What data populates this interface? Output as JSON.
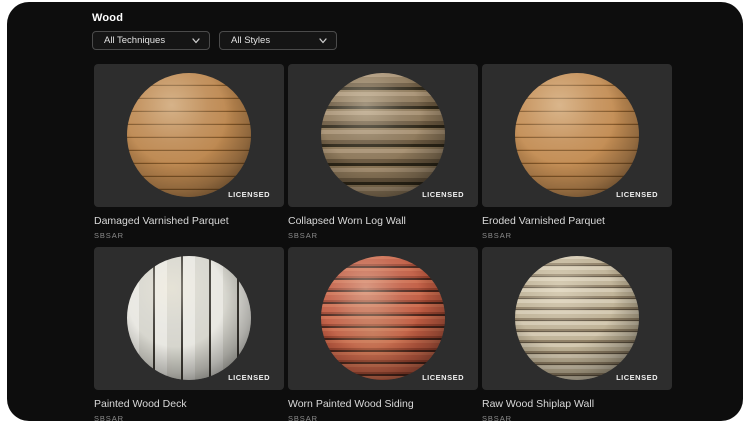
{
  "header": {
    "title": "Wood"
  },
  "filters": {
    "technique": {
      "value": "All Techniques"
    },
    "style": {
      "value": "All Styles"
    }
  },
  "cards": [
    {
      "title": "Damaged Varnished Parquet",
      "format": "SBSAR",
      "badge": "LICENSED",
      "material": "varnished-parquet",
      "base_color": "#b5804a"
    },
    {
      "title": "Collapsed Worn Log Wall",
      "format": "SBSAR",
      "badge": "LICENSED",
      "material": "log-wall",
      "base_color": "#8a7b62"
    },
    {
      "title": "Eroded Varnished Parquet",
      "format": "SBSAR",
      "badge": "LICENSED",
      "material": "eroded-parquet",
      "base_color": "#bd8750"
    },
    {
      "title": "Painted Wood Deck",
      "format": "SBSAR",
      "badge": "LICENSED",
      "material": "painted-deck",
      "base_color": "#e4e3dd"
    },
    {
      "title": "Worn Painted Wood Siding",
      "format": "SBSAR",
      "badge": "LICENSED",
      "material": "painted-siding",
      "base_color": "#c25f45"
    },
    {
      "title": "Raw Wood Shiplap Wall",
      "format": "SBSAR",
      "badge": "LICENSED",
      "material": "shiplap",
      "base_color": "#c2b59b"
    }
  ],
  "colors": {
    "page_background": "#ffffff",
    "panel_background": "#0d0d0d",
    "card_background": "#2d2d2d",
    "title_text": "#d9d9d9",
    "format_text": "#8c8c8c",
    "dropdown_border": "#4b4b4b"
  }
}
